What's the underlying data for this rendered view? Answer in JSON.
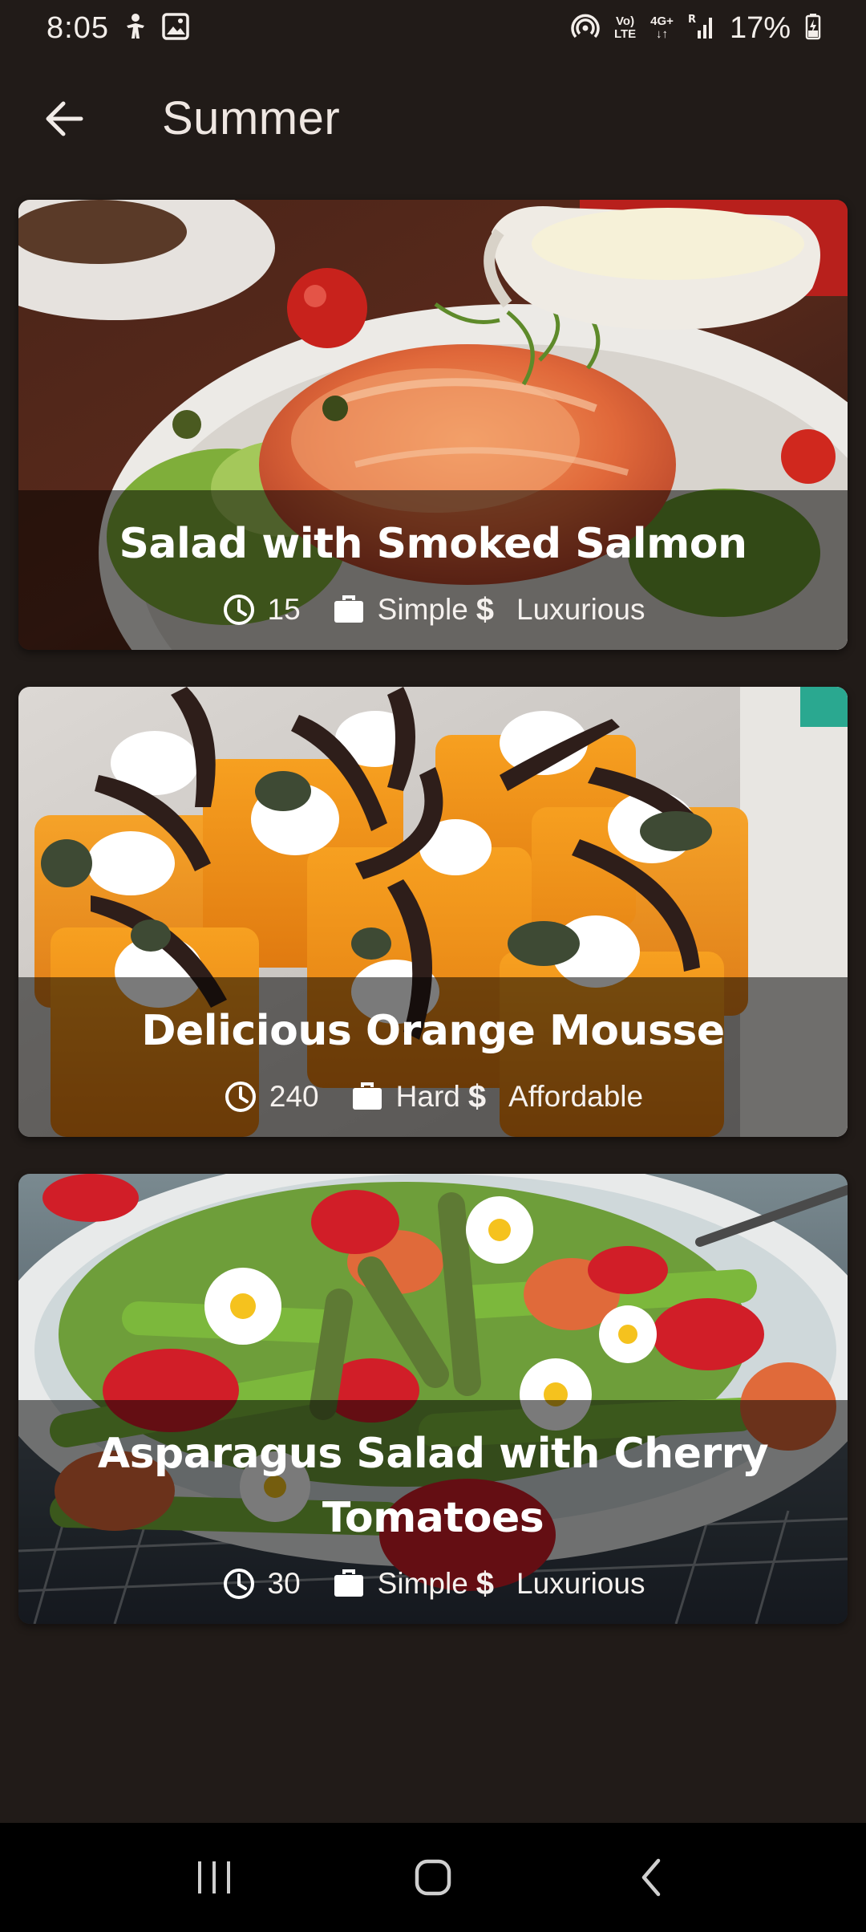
{
  "status_bar": {
    "time": "8:05",
    "battery": "17%",
    "volte_top": "Vo)",
    "volte_bottom": "LTE",
    "network_top": "4G+",
    "network_bottom": "↓↑",
    "roaming": "R"
  },
  "app_bar": {
    "title": "Summer"
  },
  "meals": [
    {
      "title": "Salad with Smoked Salmon",
      "duration": "15",
      "complexity": "Simple",
      "affordability": "Luxurious"
    },
    {
      "title": "Delicious Orange Mousse",
      "duration": "240",
      "complexity": "Hard",
      "affordability": "Affordable"
    },
    {
      "title": "Asparagus Salad with Cherry Tomatoes",
      "duration": "30",
      "complexity": "Simple",
      "affordability": "Luxurious"
    }
  ],
  "meta_icons": {
    "duration": "clock-icon",
    "complexity": "briefcase-icon",
    "affordability": "dollar-icon",
    "dollar_symbol": "$"
  },
  "colors": {
    "background": "#211b18",
    "overlay": "rgba(0,0,0,0.52)",
    "text": "#ffffff",
    "nav_bar": "#000000"
  }
}
